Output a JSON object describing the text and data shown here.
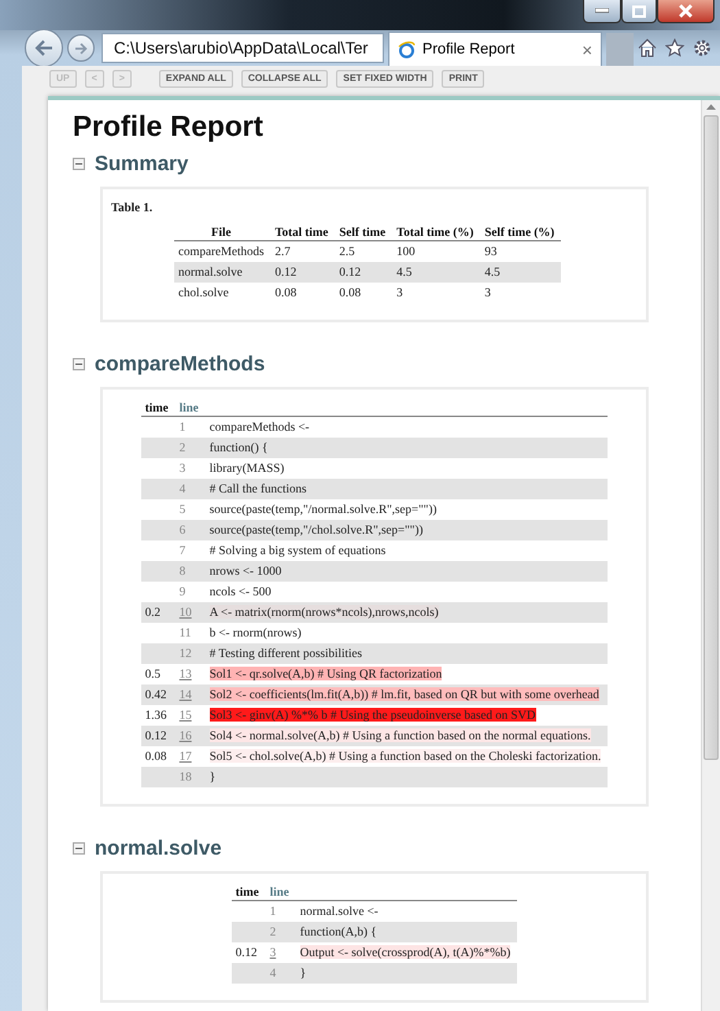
{
  "browser": {
    "address": "C:\\Users\\arubio\\AppData\\Local\\Ter",
    "tab_title": "Profile Report",
    "tab_close": "×"
  },
  "toolbar": [
    {
      "label": "UP",
      "disabled": true
    },
    {
      "label": "<",
      "disabled": true
    },
    {
      "label": ">",
      "disabled": true
    },
    {
      "label": "EXPAND ALL",
      "disabled": false
    },
    {
      "label": "COLLAPSE ALL",
      "disabled": false
    },
    {
      "label": "SET FIXED WIDTH",
      "disabled": false
    },
    {
      "label": "PRINT",
      "disabled": false
    }
  ],
  "title": "Profile Report",
  "sections": [
    {
      "kind": "table",
      "title": "Summary",
      "expanded": true,
      "caption": "Table 1.",
      "columns": [
        "File",
        "Total time",
        "Self time",
        "Total time (%)",
        "Self time (%)"
      ],
      "rows": [
        [
          "compareMethods",
          "2.7",
          "2.5",
          "100",
          "93"
        ],
        [
          "normal.solve",
          "0.12",
          "0.12",
          "4.5",
          "4.5"
        ],
        [
          "chol.solve",
          "0.08",
          "0.08",
          "3",
          "3"
        ]
      ]
    },
    {
      "kind": "code",
      "title": "compareMethods",
      "expanded": true,
      "columns": [
        "time",
        "line"
      ],
      "lines": [
        {
          "number": "1",
          "code": "compareMethods <-"
        },
        {
          "number": "2",
          "code": "function() {"
        },
        {
          "number": "3",
          "code": "library(MASS)"
        },
        {
          "number": "4",
          "code": "# Call the functions"
        },
        {
          "number": "5",
          "code": "source(paste(temp,\"/normal.solve.R\",sep=\"\"))"
        },
        {
          "number": "6",
          "code": "source(paste(temp,\"/chol.solve.R\",sep=\"\"))"
        },
        {
          "number": "7",
          "code": "# Solving a big system of equations"
        },
        {
          "number": "8",
          "code": "nrows <- 1000"
        },
        {
          "number": "9",
          "code": "ncols <- 500"
        },
        {
          "time": "0.2",
          "number": "10",
          "code": "A <- matrix(rnorm(nrows*ncols),nrows,ncols)",
          "color": "#e6dede"
        },
        {
          "number": "11",
          "code": "b <- rnorm(nrows)"
        },
        {
          "number": "12",
          "code": "# Testing different possibilities"
        },
        {
          "time": "0.5",
          "number": "13",
          "code": "Sol1 <- qr.solve(A,b) # Using QR factorization",
          "color": "#ffb3b3"
        },
        {
          "time": "0.42",
          "number": "14",
          "code": "Sol2 <- coefficients(lm.fit(A,b)) # lm.fit, based on QR but with some overhead",
          "color": "#ffbcbc"
        },
        {
          "time": "1.36",
          "number": "15",
          "code": "Sol3 <- ginv(A) %*% b # Using the pseudoinverse based on SVD",
          "color": "#ff1a1a"
        },
        {
          "time": "0.12",
          "number": "16",
          "code": "Sol4 <- normal.solve(A,b) # Using a function based on the normal equations.",
          "color": "#fde6e6"
        },
        {
          "time": "0.08",
          "number": "17",
          "code": "Sol5 <- chol.solve(A,b) # Using a function based on the Choleski factorization.",
          "color": "#fdeeee"
        },
        {
          "number": "18",
          "code": "}"
        }
      ]
    },
    {
      "kind": "code",
      "title": "normal.solve",
      "expanded": true,
      "columns": [
        "time",
        "line"
      ],
      "lines": [
        {
          "number": "1",
          "code": "normal.solve <-"
        },
        {
          "number": "2",
          "code": "function(A,b) {"
        },
        {
          "time": "0.12",
          "number": "3",
          "code": "Output <- solve(crossprod(A), t(A)%*%b)",
          "color": "#fde4e4"
        },
        {
          "number": "4",
          "code": "}"
        }
      ]
    }
  ]
}
